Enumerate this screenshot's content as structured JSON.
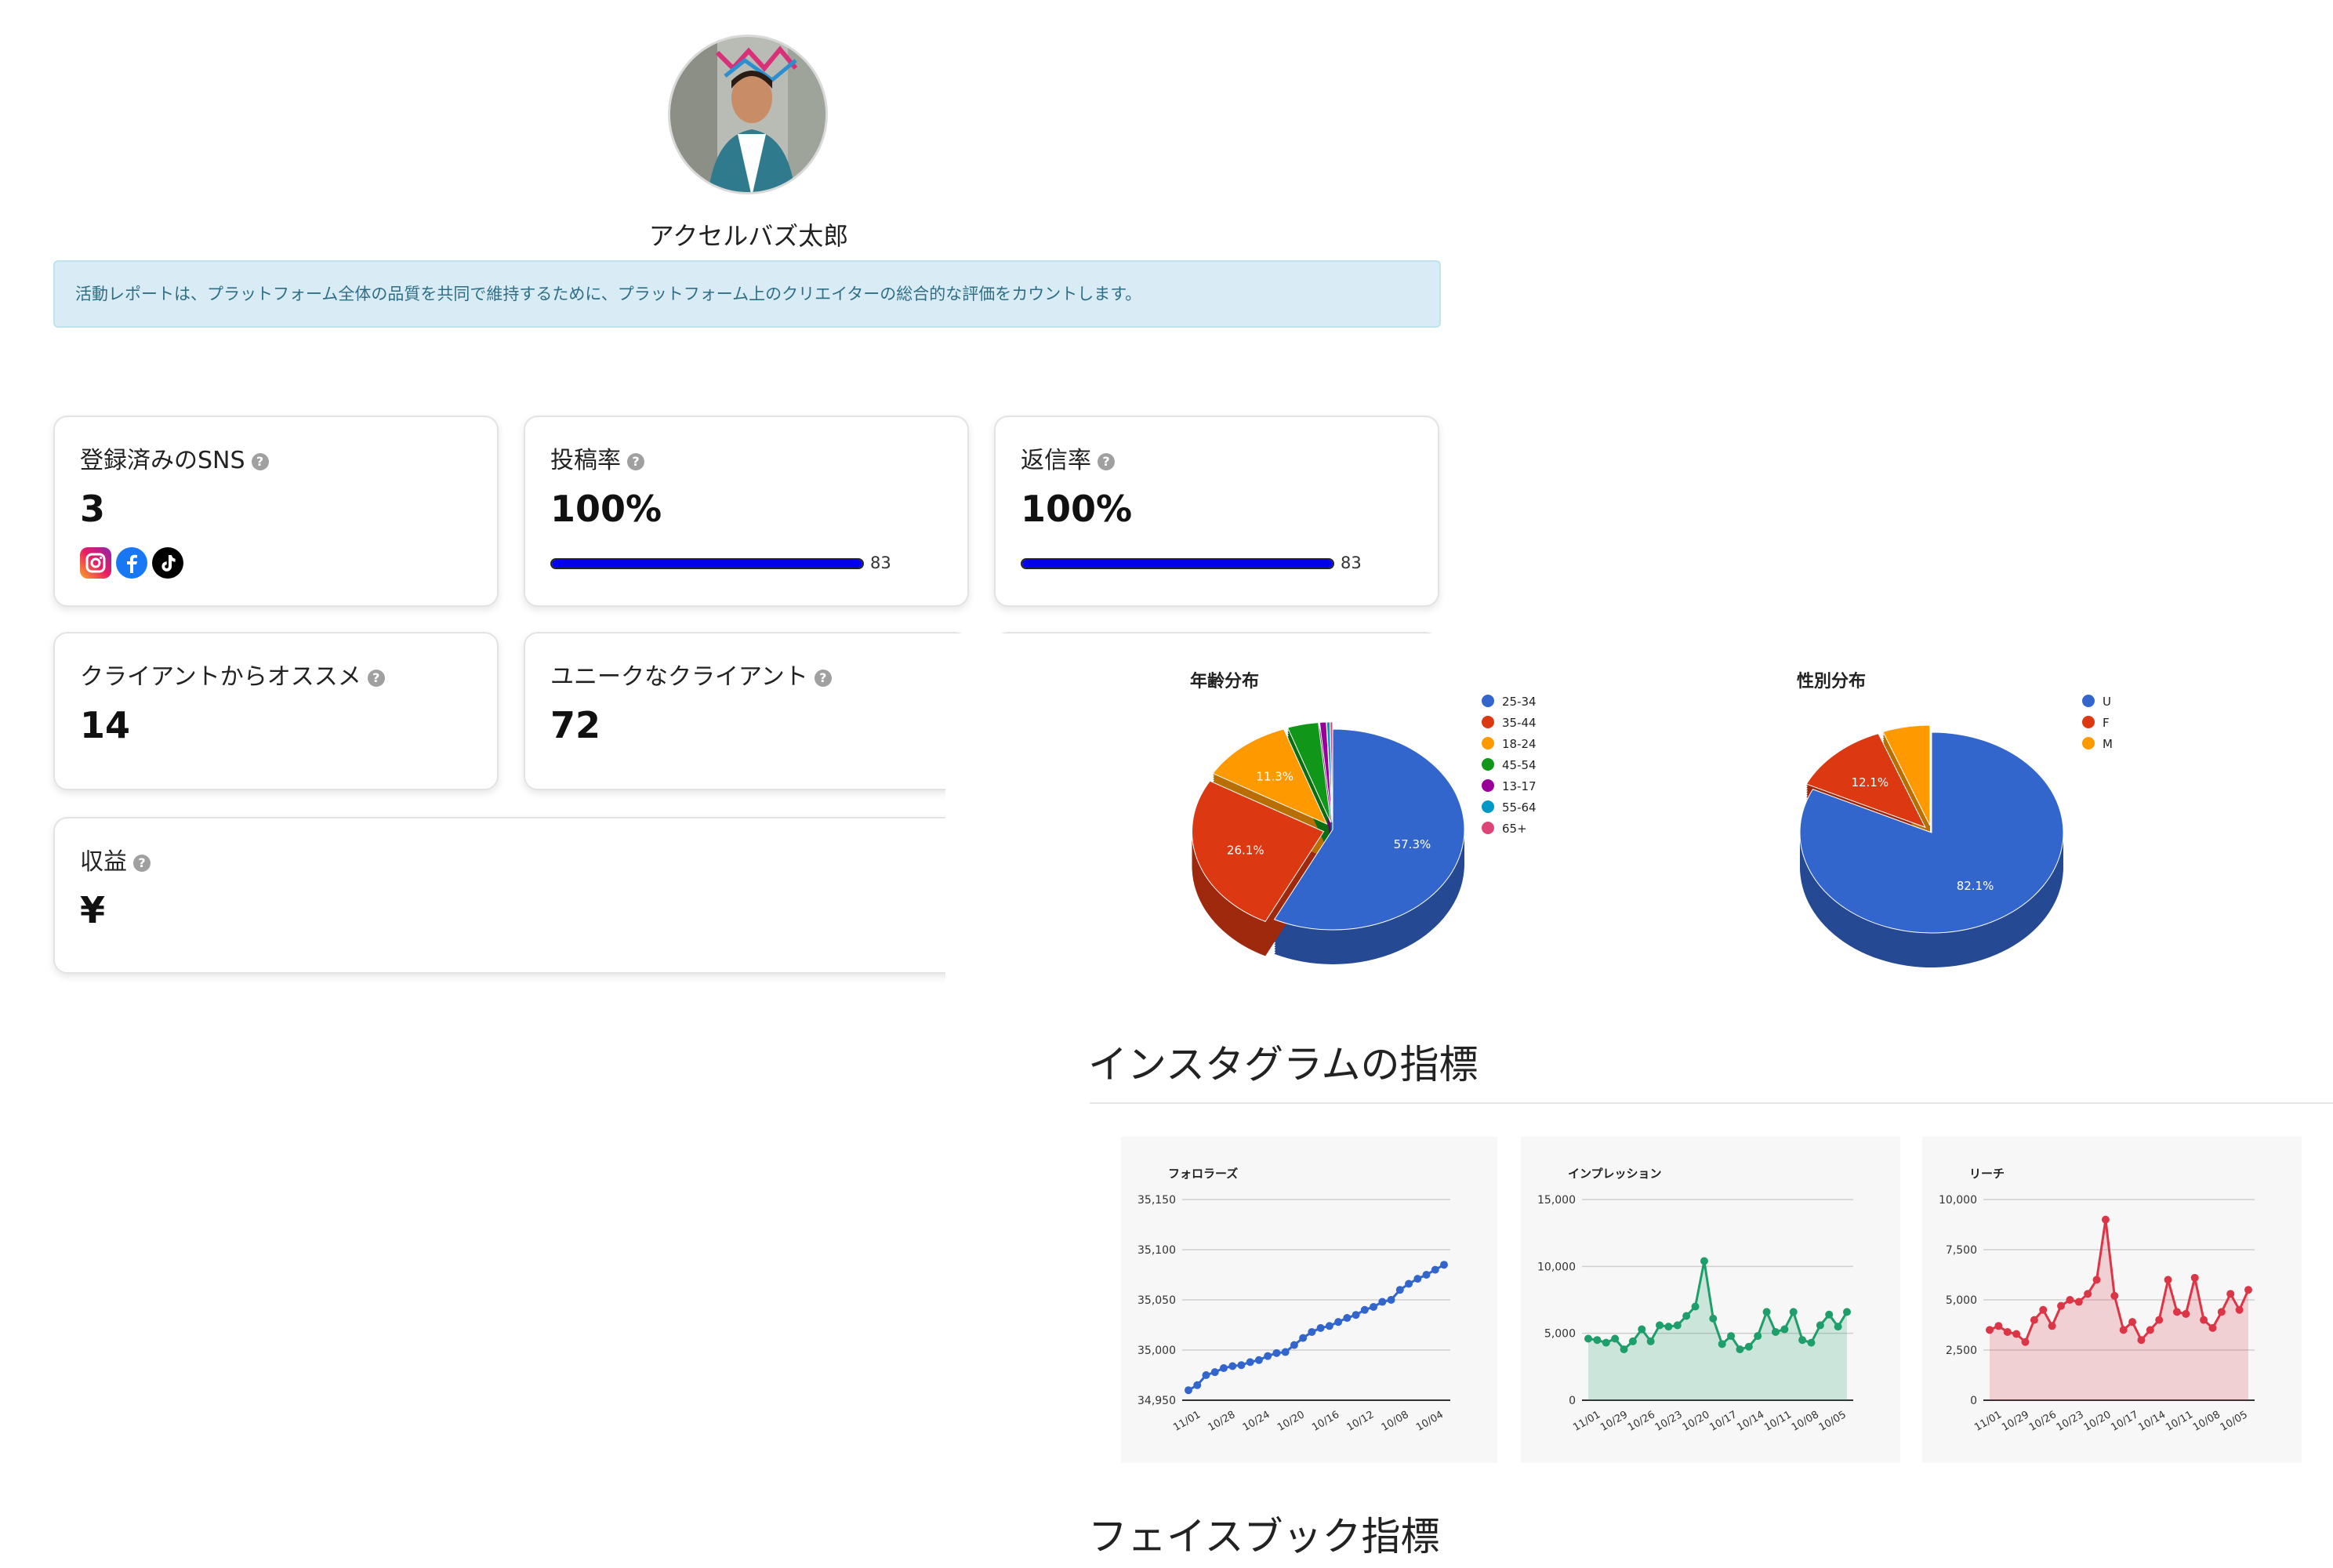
{
  "profile": {
    "name": "アクセルバズ太郎",
    "avatar_desc": "person-avatar"
  },
  "notice": "活動レポートは、プラットフォーム全体の品質を共同で維持するために、プラットフォーム上のクリエイターの総合的な評価をカウントします。",
  "cards": {
    "sns": {
      "title": "登録済みのSNS",
      "value": "3",
      "icons": [
        "instagram-icon",
        "facebook-icon",
        "tiktok-icon"
      ]
    },
    "post_rate": {
      "title": "投稿率",
      "value": "100%",
      "progress": 100,
      "progress_label": "83"
    },
    "reply_rate": {
      "title": "返信率",
      "value": "100%",
      "progress": 100,
      "progress_label": "83"
    },
    "recommend": {
      "title": "クライアントからオススメ",
      "value": "14"
    },
    "unique_clients": {
      "title": "ユニークなクライアント",
      "value": "72"
    },
    "revenue": {
      "title": "収益",
      "value": "¥"
    }
  },
  "help_glyph": "?",
  "sections": {
    "instagram": "インスタグラムの指標",
    "facebook": "フェイスブック指標"
  },
  "colors": {
    "blue": "#3366cc",
    "red": "#dc3912",
    "orange": "#ff9900",
    "green": "#109618",
    "purple": "#990099",
    "teal": "#0099c6",
    "pink": "#dd4477",
    "line_green": "#1e9e6a",
    "line_red": "#dc3545"
  },
  "chart_data": [
    {
      "type": "pie",
      "title": "年齢分布",
      "legend_position": "right",
      "categories": [
        "25-34",
        "35-44",
        "18-24",
        "45-54",
        "13-17",
        "55-64",
        "65+"
      ],
      "values": [
        57.3,
        26.1,
        11.3,
        3.8,
        0.8,
        0.4,
        0.3
      ],
      "labels": [
        "57.3%",
        "26.1%",
        "11.3%",
        "",
        "",
        "",
        ""
      ]
    },
    {
      "type": "pie",
      "title": "性別分布",
      "legend_position": "right",
      "categories": [
        "U",
        "F",
        "M"
      ],
      "values": [
        82.1,
        12.1,
        5.8
      ],
      "labels": [
        "82.1%",
        "12.1%",
        ""
      ]
    },
    {
      "type": "line",
      "title": "フォロラーズ",
      "x_ticks": [
        "11/01",
        "10/28",
        "10/24",
        "10/20",
        "10/16",
        "10/12",
        "10/08",
        "10/04"
      ],
      "y_ticks": [
        "34,950",
        "35,000",
        "35,050",
        "35,100",
        "35,150"
      ],
      "ylim": [
        34950,
        35150
      ],
      "values": [
        34960,
        34965,
        34975,
        34978,
        34982,
        34984,
        34985,
        34988,
        34990,
        34994,
        34997,
        34998,
        35005,
        35012,
        35018,
        35022,
        35024,
        35028,
        35032,
        35035,
        35040,
        35043,
        35048,
        35050,
        35060,
        35066,
        35071,
        35075,
        35080,
        35085
      ]
    },
    {
      "type": "area",
      "title": "インプレッション",
      "x_ticks": [
        "11/01",
        "10/29",
        "10/26",
        "10/23",
        "10/20",
        "10/17",
        "10/14",
        "10/11",
        "10/08",
        "10/05"
      ],
      "y_ticks": [
        "0",
        "5,000",
        "10,000",
        "15,000"
      ],
      "ylim": [
        0,
        15000
      ],
      "values": [
        4600,
        4500,
        4300,
        4600,
        3800,
        4400,
        5300,
        4400,
        5600,
        5500,
        5600,
        6300,
        7000,
        10400,
        6100,
        4200,
        4800,
        3800,
        4000,
        4800,
        6600,
        5100,
        5300,
        6600,
        4500,
        4300,
        5600,
        6400,
        5500,
        6600
      ]
    },
    {
      "type": "area",
      "title": "リーチ",
      "x_ticks": [
        "11/01",
        "10/29",
        "10/26",
        "10/23",
        "10/20",
        "10/17",
        "10/14",
        "10/11",
        "10/08",
        "10/05"
      ],
      "y_ticks": [
        "0",
        "2,500",
        "5,000",
        "7,500",
        "10,000"
      ],
      "ylim": [
        0,
        10000
      ],
      "values": [
        3500,
        3700,
        3400,
        3300,
        2900,
        4000,
        4500,
        3700,
        4700,
        5000,
        4900,
        5300,
        6000,
        9000,
        5200,
        3500,
        3900,
        3000,
        3500,
        4000,
        6000,
        4400,
        4300,
        6100,
        4000,
        3600,
        4400,
        5300,
        4500,
        5500
      ]
    }
  ]
}
